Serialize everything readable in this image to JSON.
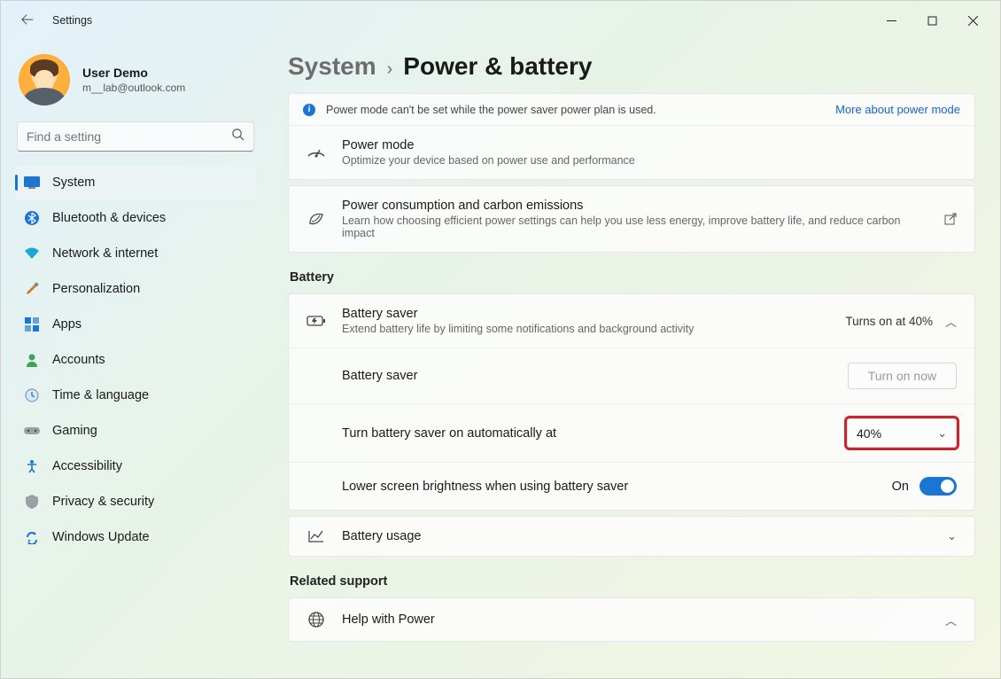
{
  "window": {
    "title": "Settings"
  },
  "profile": {
    "name": "User Demo",
    "email": "m__lab@outlook.com"
  },
  "search": {
    "placeholder": "Find a setting"
  },
  "nav": {
    "items": [
      {
        "label": "System"
      },
      {
        "label": "Bluetooth & devices"
      },
      {
        "label": "Network & internet"
      },
      {
        "label": "Personalization"
      },
      {
        "label": "Apps"
      },
      {
        "label": "Accounts"
      },
      {
        "label": "Time & language"
      },
      {
        "label": "Gaming"
      },
      {
        "label": "Accessibility"
      },
      {
        "label": "Privacy & security"
      },
      {
        "label": "Windows Update"
      }
    ]
  },
  "breadcrumb": {
    "root": "System",
    "page": "Power & battery"
  },
  "banner": {
    "text": "Power mode can't be set while the power saver power plan is used.",
    "link": "More about power mode"
  },
  "power_mode": {
    "title": "Power mode",
    "subtitle": "Optimize your device based on power use and performance"
  },
  "carbon": {
    "title": "Power consumption and carbon emissions",
    "subtitle": "Learn how choosing efficient power settings can help you use less energy, improve battery life, and reduce carbon impact"
  },
  "sections": {
    "battery": "Battery",
    "related": "Related support"
  },
  "battery_saver": {
    "title": "Battery saver",
    "subtitle": "Extend battery life by limiting some notifications and background activity",
    "status": "Turns on at 40%",
    "row_label": "Battery saver",
    "button": "Turn on now",
    "auto_label": "Turn battery saver on automatically at",
    "auto_value": "40%",
    "brightness_label": "Lower screen brightness when using battery saver",
    "brightness_state": "On"
  },
  "battery_usage": {
    "title": "Battery usage"
  },
  "help": {
    "title": "Help with Power"
  }
}
